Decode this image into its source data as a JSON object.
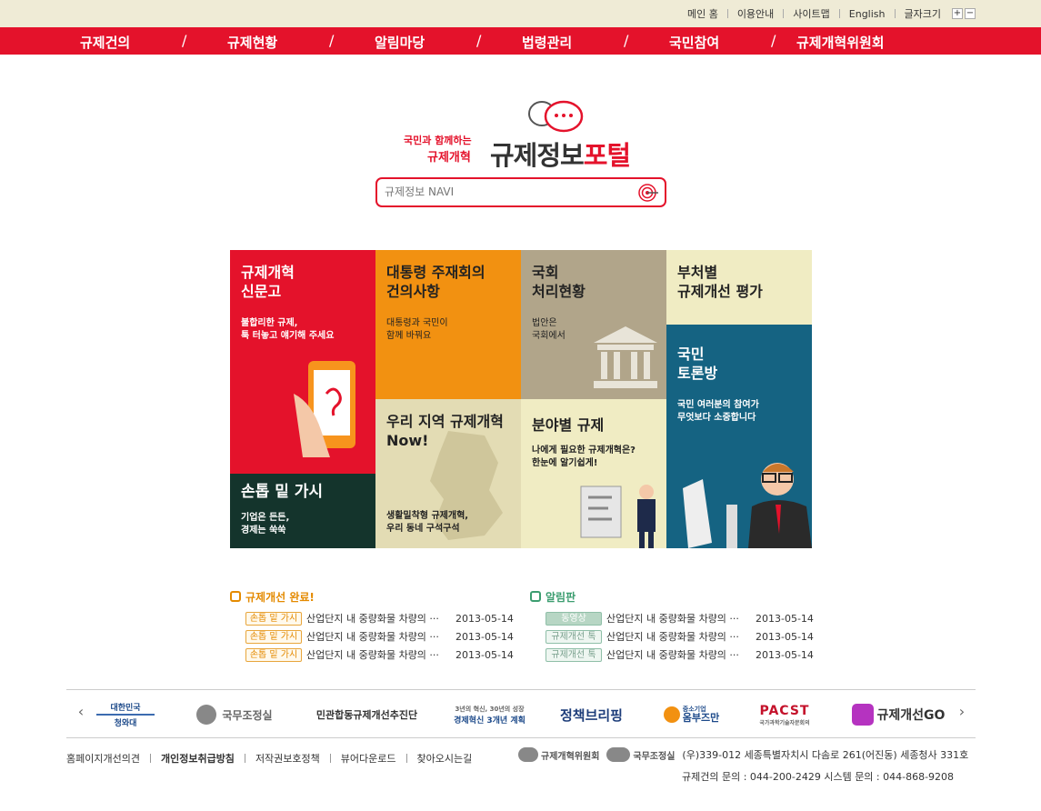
{
  "util_links": [
    "메인 홈",
    "이용안내",
    "사이트맵",
    "English",
    "글자크기"
  ],
  "font_size_controls": [
    "+",
    "−"
  ],
  "gnb": [
    "규제건의",
    "규제현황",
    "알림마당",
    "법령관리",
    "국민참여",
    "규제개혁위원회"
  ],
  "gnb_separator": "/",
  "logo": {
    "sub1": "국민과 함께하는",
    "sub2": "규제개혁",
    "main_a": "규제정보",
    "main_b": "포털"
  },
  "search": {
    "placeholder": "규제정보 NAVI"
  },
  "tiles": {
    "t1": {
      "title": "규제개혁\n신문고",
      "desc": "불합리한 규제,\n툭 터놓고 얘기해 주세요"
    },
    "t2": {
      "title": "대통령 주재회의\n건의사항",
      "desc": "대통령과 국민이\n함께 바꿔요"
    },
    "t3": {
      "title": "국회\n처리현황",
      "desc": "법안은\n국회에서"
    },
    "t4": {
      "title": "부처별\n규제개선 평가"
    },
    "t5": {
      "title": "국민\n토론방",
      "desc": "국민 여러분의 참여가\n무엇보다 소중합니다"
    },
    "t6": {
      "title": "손톱 밑 가시",
      "desc": "기업은 든든,\n경제는 쑥쑥"
    },
    "t7": {
      "title": "우리 지역 규제개혁\nNow!",
      "desc": "생활밀착형 규제개혁,\n우리 동네 구석구석"
    },
    "t8": {
      "title": "분야별 규제",
      "desc": "나에게 필요한 규제개혁은?\n한눈에 알기쉽게!"
    }
  },
  "colors": {
    "red": "#e4122b",
    "orange": "#f29111",
    "olive": "#b1a58a",
    "cream": "#f0ecc3",
    "teal": "#156382",
    "dark_green": "#14342c",
    "sand": "#e3dcb4"
  },
  "news_left": {
    "heading": "규제개선 완료!",
    "items": [
      {
        "tag": "손톱 밑 가시",
        "title": "산업단지 내 중량화물 차량의 ···",
        "date": "2013-05-14"
      },
      {
        "tag": "손톱 밑 가시",
        "title": "산업단지 내 중량화물 차량의 ···",
        "date": "2013-05-14"
      },
      {
        "tag": "손톱 밑 가시",
        "title": "산업단지 내 중량화물 차량의 ···",
        "date": "2013-05-14"
      }
    ]
  },
  "news_right": {
    "heading": "알림판",
    "items": [
      {
        "tag": "동영상",
        "title": "산업단지 내 중량화물 차량의 ···",
        "date": "2013-05-14"
      },
      {
        "tag": "규제개선 톡",
        "title": "산업단지 내 중량화물 차량의 ···",
        "date": "2013-05-14"
      },
      {
        "tag": "규제개선 톡",
        "title": "산업단지 내 중량화물 차량의 ···",
        "date": "2013-05-14"
      }
    ]
  },
  "banners": [
    "청와대",
    "국무조정실",
    "민관합동규제개선추진단",
    "경제혁신 3개년 계획",
    "정책브리핑",
    "옴부즈만",
    "PACST",
    "규제개선GO"
  ],
  "banner_subs": {
    "b1_top": "대한민국",
    "b4_top": "3년의 혁신, 30년의 성장",
    "b6_top": "중소기업",
    "b7_sub": "국가과학기술자문회의"
  },
  "footer_links": [
    "홈페이지개선의견",
    "개인정보취급방침",
    "저작권보호정책",
    "뷰어다운로드",
    "찾아오시는길"
  ],
  "footer_orgs": [
    "규제개혁위원회",
    "국무조정실"
  ],
  "footer_address": "(우)339-012 세종특별자치시 다솜로 261(어진동) 세종청사 331호",
  "footer_contact": "규제건의 문의 : 044-200-2429   시스템 문의 : 044-868-9208"
}
